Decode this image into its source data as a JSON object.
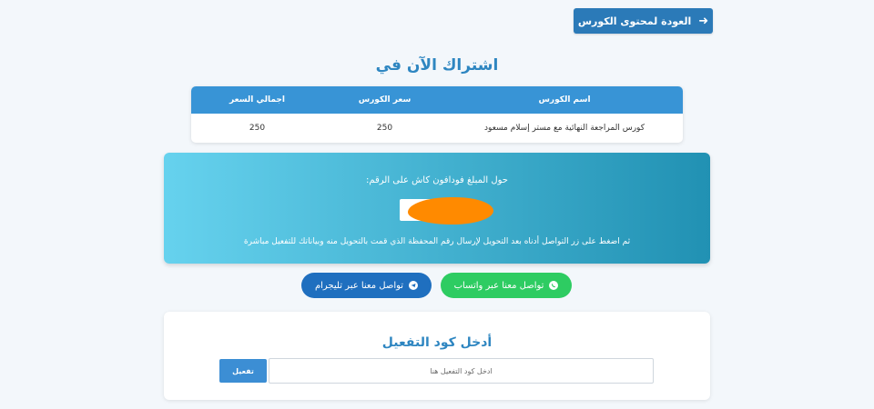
{
  "header": {
    "back_label": "العودة لمحتوى الكورس",
    "back_icon": "arrow-right-icon"
  },
  "subscribe": {
    "title": "اشتراك الآن في"
  },
  "table": {
    "columns": [
      "اسم الكورس",
      "سعر الكورس",
      "اجمالي السعر"
    ],
    "rows": [
      [
        "كورس المراجعة النهائية مع مستر إسلام مسعود",
        "250",
        "250"
      ]
    ]
  },
  "payment": {
    "instruction": "حول المبلغ فودافون كاش على الرقم:",
    "phone_number": "",
    "note": "ثم اضغط على زر التواصل أدناه بعد التحويل لإرسال رقم المحفظة الذي قمت بالتحويل منه وبياناتك للتفعيل مباشرة",
    "gradient_start": "#66d2ee",
    "gradient_end": "#2191b3"
  },
  "contact": {
    "whatsapp_label": "تواصل معنا عبر واتساب",
    "whatsapp_icon": "whatsapp-icon",
    "whatsapp_color": "#2ecc62",
    "telegram_label": "تواصل معنا عبر تليجرام",
    "telegram_icon": "telegram-icon",
    "telegram_color": "#1f6fbf"
  },
  "activation": {
    "title": "أدخل كود التفعيل",
    "input_placeholder": "ادخل كود التفعيل هنا",
    "input_value": "",
    "button_label": "تفعيل"
  },
  "colors": {
    "accent": "#2e86c1",
    "table_header": "#3894d6",
    "primary_button": "#2b7ab8"
  }
}
